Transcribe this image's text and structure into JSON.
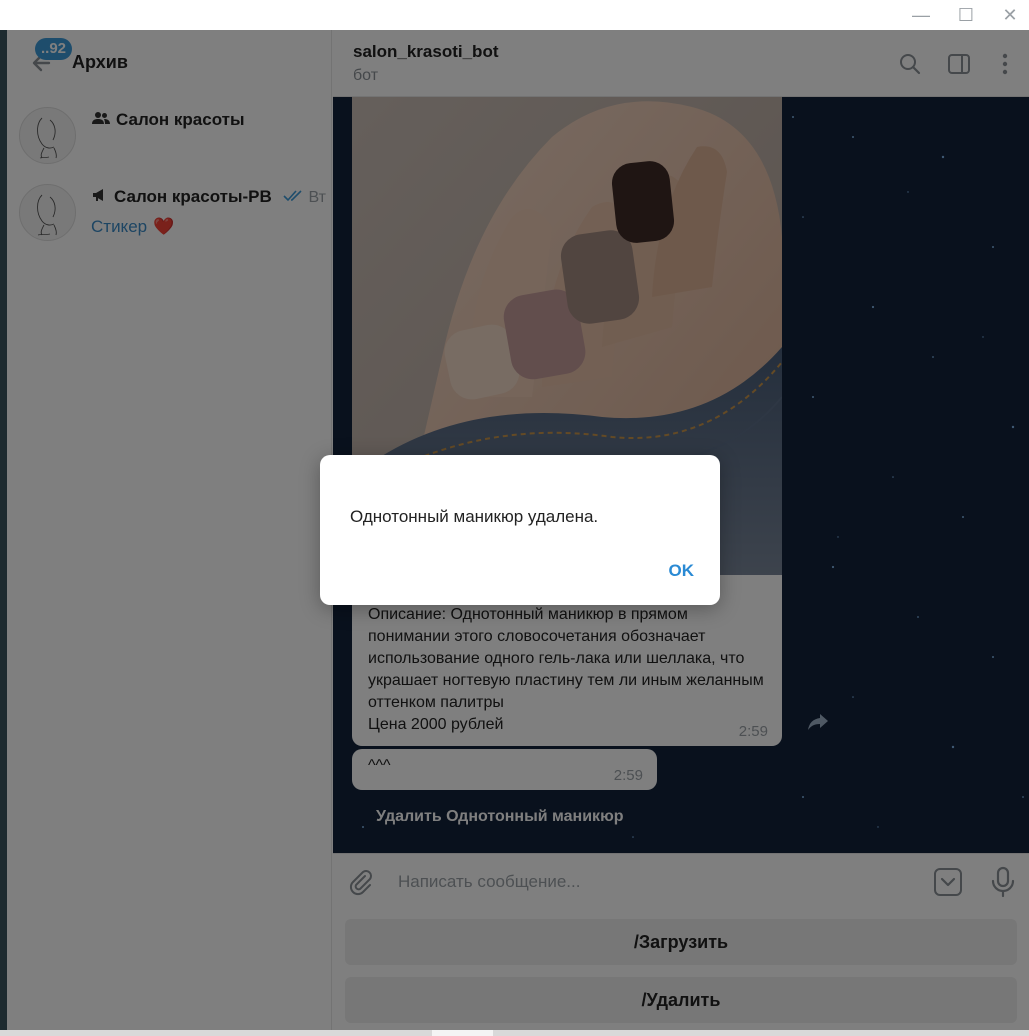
{
  "window": {
    "minimize_glyph": "—",
    "maximize_glyph": "☐",
    "close_glyph": "✕"
  },
  "sidebar": {
    "title": "Архив",
    "unread_badge": "..92",
    "chats": [
      {
        "name": "Салон красоты",
        "type_icon": "group-icon",
        "time": "",
        "preview": ""
      },
      {
        "name": "Салон красоты-РВ",
        "type_icon": "channel-icon",
        "time": "Вт",
        "preview": "Стикер",
        "preview_emoji": "❤️"
      }
    ]
  },
  "header": {
    "bot_name": "salon_krasoti_bot",
    "status": "бот"
  },
  "messages": {
    "photo_caption": "Описание: Однотонный маникюр в прямом понимании этого словосочетания обозначает использование одного гель-лака или шеллака, что украшает ногтевую пластину тем ли иным желанным оттенком палитры\nЦена 2000 рублей",
    "photo_time": "2:59",
    "small_text": "^^^",
    "small_time": "2:59",
    "inline_button": "Удалить Однотонный маникюр"
  },
  "input": {
    "placeholder": "Написать сообщение..."
  },
  "keyboard": {
    "buttons": [
      "/Загрузить",
      "/Удалить"
    ]
  },
  "dialog": {
    "text": "Однотонный маникюр удалена.",
    "ok_label": "OK"
  },
  "colors": {
    "accent": "#2a8ad4",
    "badge": "#3d9ad8",
    "preview_link": "#3a8bc7",
    "chat_bg": "#12223a"
  }
}
